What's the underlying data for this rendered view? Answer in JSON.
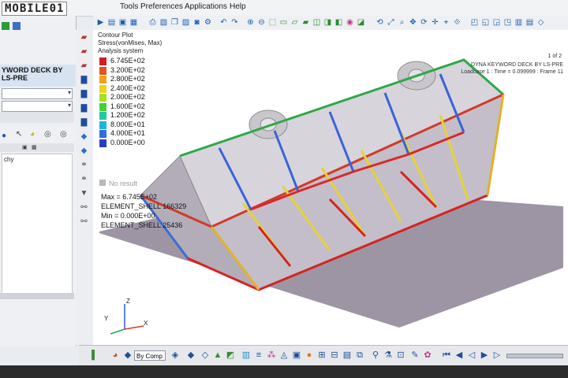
{
  "watermark": {
    "text": "MOBILE01"
  },
  "menus": {
    "tools": "Tools",
    "preferences": "Preferences",
    "applications": "Applications",
    "help": "Help"
  },
  "left_panel": {
    "header": "YWORD DECK BY LS-PRE",
    "tree_label": "chy"
  },
  "viewport": {
    "plot_title": "Contour Plot",
    "plot_subtitle": "Stress(vonMises, Max)",
    "plot_system": "Analysis system",
    "legend": [
      {
        "value": "6.745E+02",
        "color": "#d01f1f"
      },
      {
        "value": "3.200E+02",
        "color": "#e5521a"
      },
      {
        "value": "2.800E+02",
        "color": "#f0a21c"
      },
      {
        "value": "2.400E+02",
        "color": "#ead51c"
      },
      {
        "value": "2.000E+02",
        "color": "#a8e024"
      },
      {
        "value": "1.600E+02",
        "color": "#3fd232"
      },
      {
        "value": "1.200E+02",
        "color": "#22c7a4"
      },
      {
        "value": "8.000E+01",
        "color": "#1fb4e0"
      },
      {
        "value": "4.000E+01",
        "color": "#2f6fe0"
      },
      {
        "value": "0.000E+00",
        "color": "#2b3bc9"
      }
    ],
    "no_result": "No result",
    "max_label": "Max = 6.745E+02",
    "max_element": "ELEMENT_SHELL 166329",
    "min_label": "Min = 0.000E+00",
    "min_element": "ELEMENT_SHELL 25436",
    "right_info_line1": "DYNA KEYWORD DECK BY LS-PRE",
    "right_info_line2": "Loadcase 1 : Time = 0.099999 : Frame 11",
    "frame_tag": "1 of 2",
    "axis_z": "Z",
    "axis_y": "Y",
    "axis_x": "X"
  },
  "bottom_toolbar": {
    "by_comp": "By Comp"
  }
}
